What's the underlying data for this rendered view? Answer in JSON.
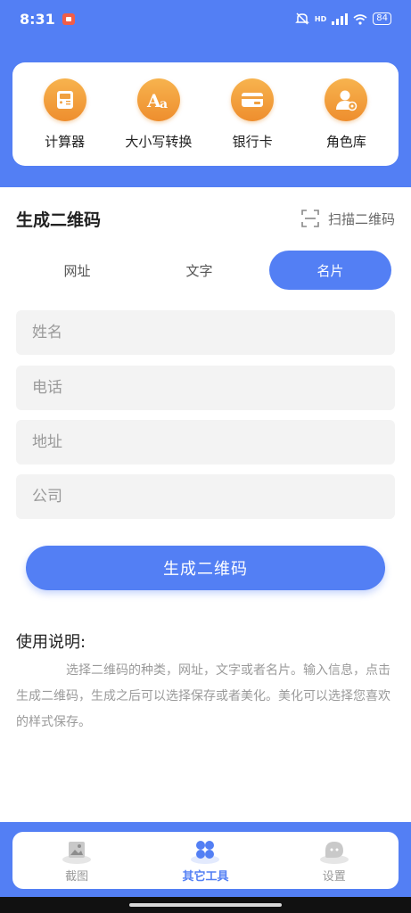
{
  "status": {
    "time": "8:31",
    "battery": "84",
    "network": "HD"
  },
  "tools": [
    {
      "label": "计算器",
      "icon": "calculator-icon"
    },
    {
      "label": "大小写转换",
      "icon": "case-convert-icon"
    },
    {
      "label": "银行卡",
      "icon": "bank-card-icon"
    },
    {
      "label": "角色库",
      "icon": "role-library-icon"
    }
  ],
  "section": {
    "title": "生成二维码",
    "scan_label": "扫描二维码"
  },
  "tabs": [
    {
      "label": "网址",
      "active": false
    },
    {
      "label": "文字",
      "active": false
    },
    {
      "label": "名片",
      "active": true
    }
  ],
  "form": {
    "name_placeholder": "姓名",
    "phone_placeholder": "电话",
    "address_placeholder": "地址",
    "company_placeholder": "公司"
  },
  "generate_label": "生成二维码",
  "help": {
    "title": "使用说明:",
    "body": "选择二维码的种类，网址，文字或者名片。输入信息，点击生成二维码，生成之后可以选择保存或者美化。美化可以选择您喜欢的样式保存。"
  },
  "nav": [
    {
      "label": "截图",
      "icon": "screenshot-icon",
      "active": false
    },
    {
      "label": "其它工具",
      "icon": "tools-grid-icon",
      "active": true
    },
    {
      "label": "设置",
      "icon": "settings-icon",
      "active": false
    }
  ],
  "colors": {
    "primary": "#537ff4",
    "accent": "#ef922f",
    "field_bg": "#f3f3f3"
  }
}
